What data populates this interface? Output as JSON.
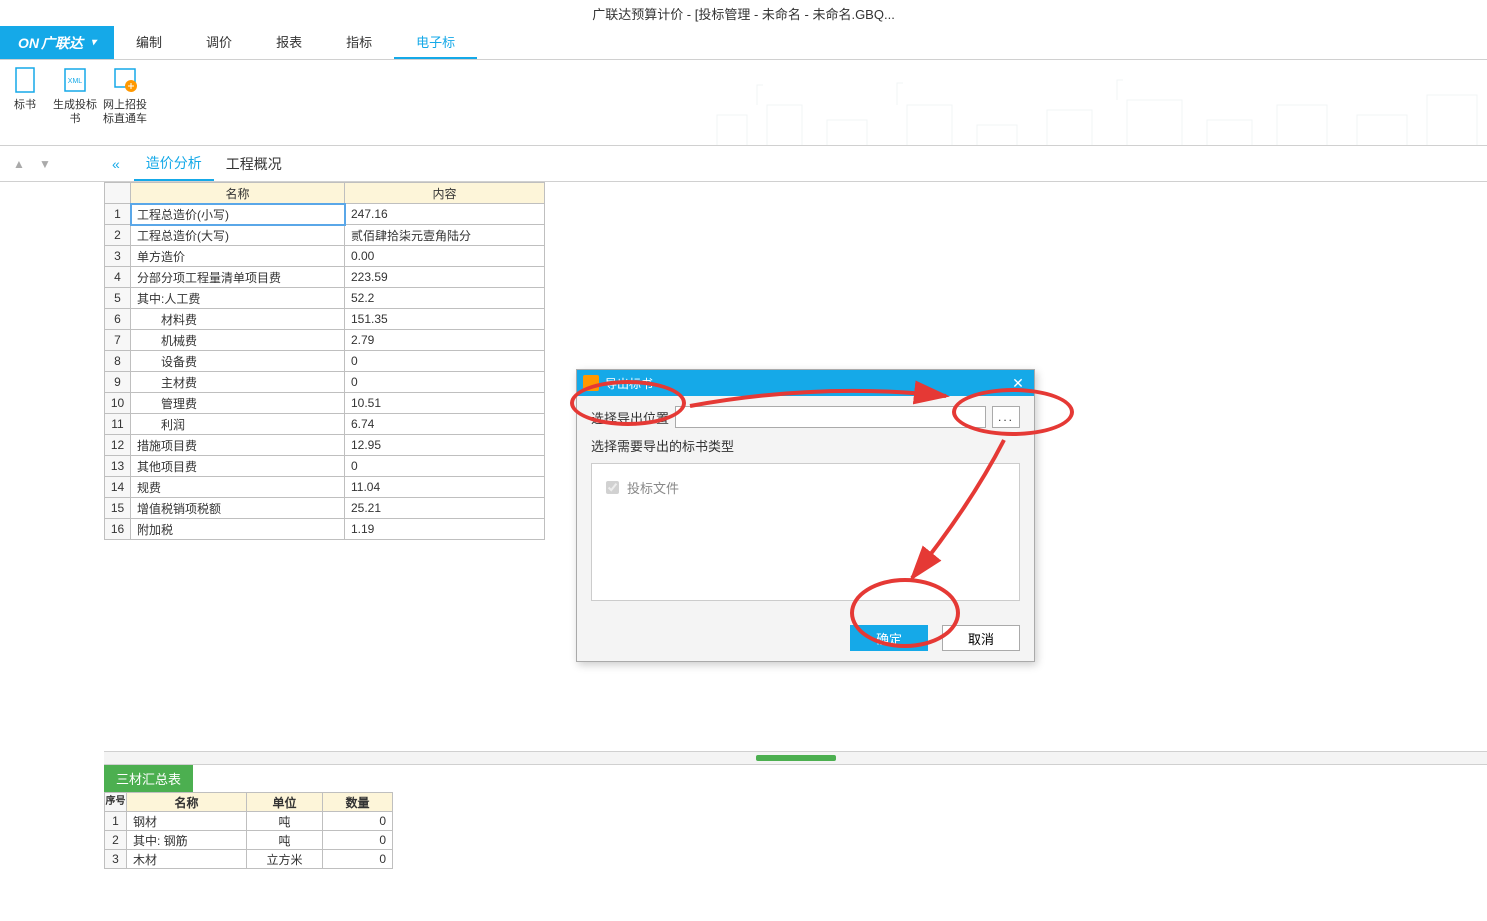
{
  "window": {
    "title": "广联达预算计价 - [投标管理 - 未命名 - 未命名.GBQ..."
  },
  "brand": {
    "label": "广联达"
  },
  "menu": {
    "items": [
      {
        "label": "编制"
      },
      {
        "label": "调价"
      },
      {
        "label": "报表"
      },
      {
        "label": "指标"
      },
      {
        "label": "电子标",
        "active": true
      }
    ]
  },
  "ribbon": {
    "items": [
      {
        "label": "标书"
      },
      {
        "label": "生成投标书"
      },
      {
        "label": "网上招投标直通车"
      }
    ]
  },
  "subtabs": {
    "items": [
      {
        "label": "造价分析",
        "active": true
      },
      {
        "label": "工程概况"
      }
    ]
  },
  "main_table": {
    "headers": {
      "name": "名称",
      "value": "内容"
    },
    "rows": [
      {
        "n": "1",
        "name": "工程总造价(小写)",
        "value": "247.16",
        "selected": true
      },
      {
        "n": "2",
        "name": "工程总造价(大写)",
        "value": "贰佰肆拾柒元壹角陆分"
      },
      {
        "n": "3",
        "name": "单方造价",
        "value": "0.00"
      },
      {
        "n": "4",
        "name": "分部分项工程量清单项目费",
        "value": "223.59"
      },
      {
        "n": "5",
        "name": "其中:人工费",
        "value": "52.2"
      },
      {
        "n": "6",
        "name": "　　材料费",
        "value": "151.35"
      },
      {
        "n": "7",
        "name": "　　机械费",
        "value": "2.79"
      },
      {
        "n": "8",
        "name": "　　设备费",
        "value": "0"
      },
      {
        "n": "9",
        "name": "　　主材费",
        "value": "0"
      },
      {
        "n": "10",
        "name": "　　管理费",
        "value": "10.51"
      },
      {
        "n": "11",
        "name": "　　利润",
        "value": "6.74"
      },
      {
        "n": "12",
        "name": "措施项目费",
        "value": "12.95"
      },
      {
        "n": "13",
        "name": "其他项目费",
        "value": "0"
      },
      {
        "n": "14",
        "name": "规费",
        "value": "11.04"
      },
      {
        "n": "15",
        "name": "增值税销项税额",
        "value": "25.21"
      },
      {
        "n": "16",
        "name": "附加税",
        "value": "1.19"
      }
    ]
  },
  "dialog": {
    "title": "导出标书",
    "location_label": "选择导出位置",
    "location_value": "",
    "browse_label": "...",
    "subtitle": "选择需要导出的标书类型",
    "option1": "投标文件",
    "ok": "确定",
    "cancel": "取消"
  },
  "bottom": {
    "tab": "三材汇总表",
    "headers": {
      "seq": "序号",
      "name": "名称",
      "unit": "单位",
      "qty": "数量"
    },
    "rows": [
      {
        "n": "1",
        "name": "钢材",
        "unit": "吨",
        "qty": "0"
      },
      {
        "n": "2",
        "name": "其中: 钢筋",
        "unit": "吨",
        "qty": "0"
      },
      {
        "n": "3",
        "name": "木材",
        "unit": "立方米",
        "qty": "0"
      }
    ]
  },
  "colors": {
    "accent": "#15a9e8",
    "anno": "#e53935",
    "green": "#4caf50"
  }
}
